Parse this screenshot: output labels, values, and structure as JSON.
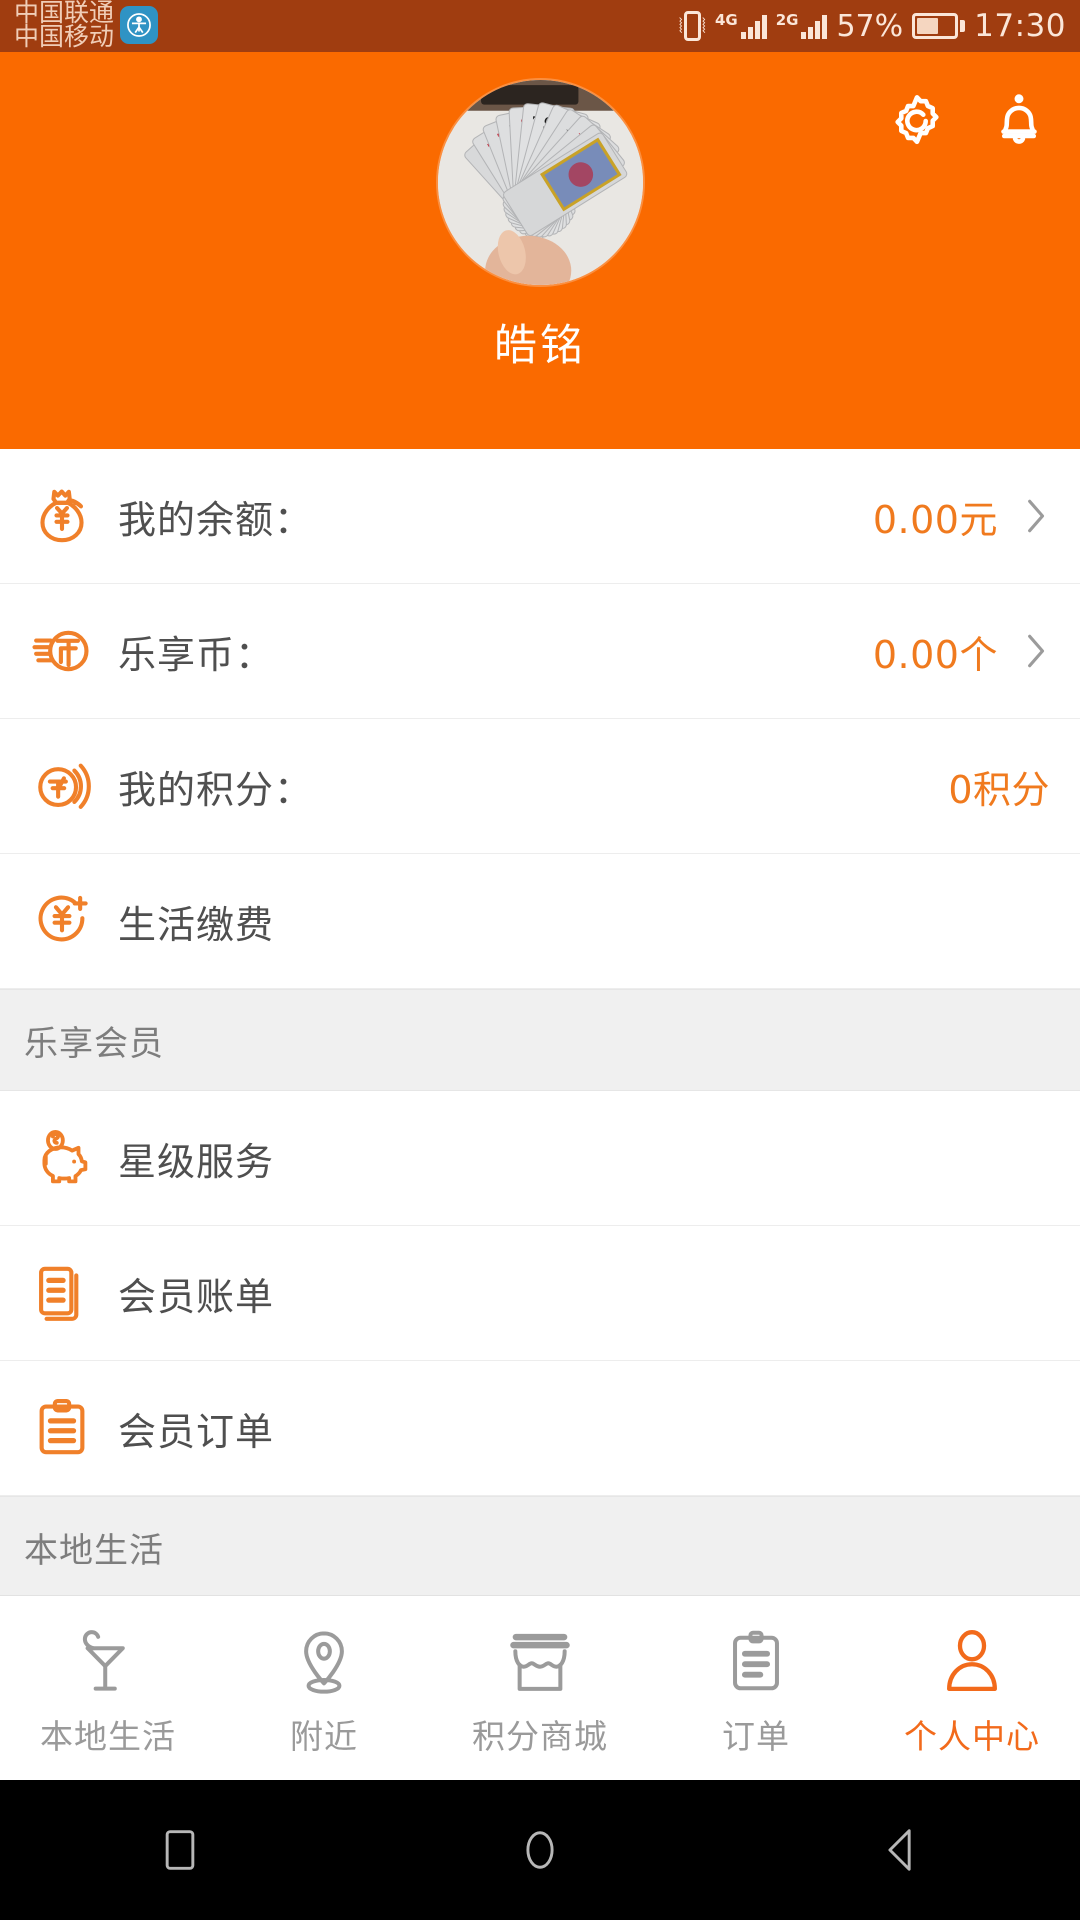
{
  "statusbar": {
    "carrier_primary": "中国联通",
    "carrier_secondary": "中国移动",
    "app_badge_icon": "person-app-icon",
    "vibrate_icon": "vibrate-icon",
    "network_1": "4G",
    "network_2": "2G",
    "battery_percent": "57%",
    "battery_level": 57,
    "time": "17:30"
  },
  "header": {
    "settings_icon": "gear-icon",
    "notification_icon": "bell-icon",
    "avatar_icon": "avatar",
    "username": "皓铭",
    "background_color": "#fa6a00"
  },
  "account_rows": [
    {
      "icon": "money-bag-icon",
      "label": "我的余额：",
      "value": "0.00元",
      "chevron": true
    },
    {
      "icon": "coin-icon",
      "label": "乐享币：",
      "value": "0.00个",
      "chevron": true
    },
    {
      "icon": "points-icon",
      "label": "我的积分：",
      "value": "0积分",
      "chevron": false
    },
    {
      "icon": "pay-yuan-icon",
      "label": "生活缴费",
      "value": "",
      "chevron": false
    }
  ],
  "member_section": {
    "title": "乐享会员",
    "rows": [
      {
        "icon": "piggy-bank-icon",
        "label": "星级服务"
      },
      {
        "icon": "bill-icon",
        "label": "会员账单"
      },
      {
        "icon": "clipboard-icon",
        "label": "会员订单"
      }
    ]
  },
  "local_section": {
    "title": "本地生活"
  },
  "tabbar": {
    "items": [
      {
        "icon": "cocktail-icon",
        "label": "本地生活",
        "active": false
      },
      {
        "icon": "map-pin-icon",
        "label": "附近",
        "active": false
      },
      {
        "icon": "shop-icon",
        "label": "积分商城",
        "active": false
      },
      {
        "icon": "order-icon",
        "label": "订单",
        "active": false
      },
      {
        "icon": "person-icon",
        "label": "个人中心",
        "active": true
      }
    ],
    "active_color": "#f26a1b",
    "inactive_color": "#9a9a9a"
  },
  "navbar": {
    "recents_icon": "square-recents-icon",
    "home_icon": "circle-home-icon",
    "back_icon": "triangle-back-icon"
  }
}
